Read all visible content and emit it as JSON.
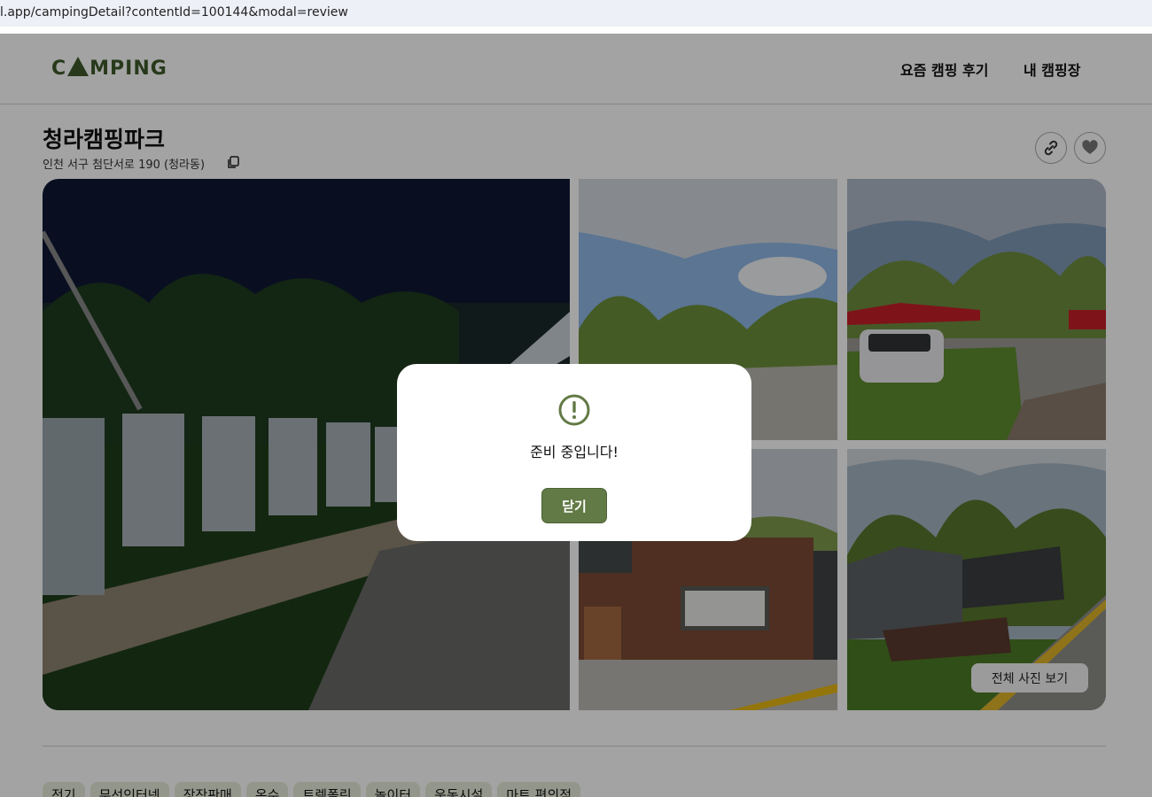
{
  "browser": {
    "url": "l.app/campingDetail?contentId=100144&modal=review"
  },
  "header": {
    "logo_text": "CAMPING",
    "nav": [
      "요즘 캠핑 후기",
      "내 캠핑장"
    ]
  },
  "camp": {
    "name": "청라캠핑파크",
    "address": "인천 서구 첨단서로 190 (청라동)"
  },
  "actions": {
    "link_icon": "link-icon",
    "heart_icon": "heart-icon",
    "copy_icon": "copy-icon"
  },
  "gallery": {
    "view_all_label": "전체 사진 보기"
  },
  "tags": [
    "전기",
    "무선인터넷",
    "장작판매",
    "온수",
    "트렘폴린",
    "놀이터",
    "운동시설",
    "마트.편의점"
  ],
  "modal": {
    "icon": "exclamation-circle-icon",
    "message": "준비 중입니다!",
    "close_label": "닫기"
  },
  "colors": {
    "brand": "#3d5a2a",
    "button": "#627a45",
    "tag_bg": "#e6ecd9"
  }
}
